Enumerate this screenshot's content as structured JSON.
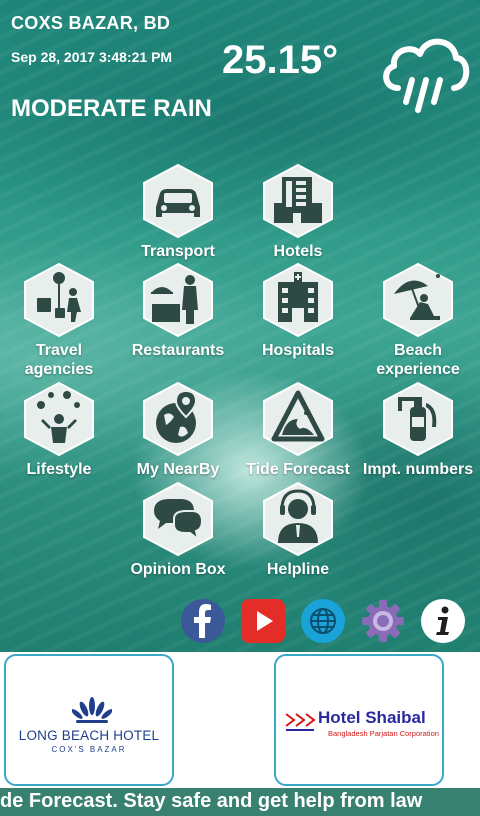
{
  "header": {
    "location": "COXS BAZAR, BD",
    "datetime": "Sep 28, 2017 3:48:21 PM",
    "temperature": "25.15°",
    "condition": "MODERATE RAIN"
  },
  "menu": {
    "transport": "Transport",
    "hotels": "Hotels",
    "travel_agencies_1": "Travel",
    "travel_agencies_2": "agencies",
    "restaurants": "Restaurants",
    "hospitals": "Hospitals",
    "beach_1": "Beach",
    "beach_2": "experience",
    "lifestyle": "Lifestyle",
    "nearby": "My NearBy",
    "tide": "Tide Forecast",
    "numbers": "Impt. numbers",
    "opinion": "Opinion Box",
    "helpline": "Helpline"
  },
  "ads": {
    "long_beach_name": "LONG BEACH HOTEL",
    "long_beach_sub": "COX'S BAZAR",
    "shaibal_name": "Hotel Shaibal",
    "shaibal_sub": "Bangladesh Parjatan Corporation"
  },
  "ticker": {
    "text": "de Forecast. Stay safe and get help from law"
  },
  "colors": {
    "facebook": "#3b5998",
    "youtube": "#e52d27",
    "web": "#1aa3d9",
    "settings": "#8a6bb8",
    "ad_border": "#3aa7c4",
    "long_beach_blue": "#1f3f8c",
    "shaibal_blue": "#2a2aa0",
    "shaibal_red": "#d01818"
  }
}
